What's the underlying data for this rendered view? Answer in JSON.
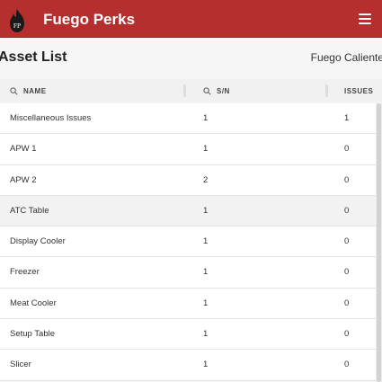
{
  "app": {
    "title": "Fuego Perks",
    "logo_text": "FP",
    "accent": "#b52f2f"
  },
  "page": {
    "title": "Asset List",
    "org": "Fuego Caliente"
  },
  "table": {
    "headers": {
      "name": "NAME",
      "sn": "S/N",
      "issues": "ISSUES"
    },
    "rows": [
      {
        "name": "Miscellaneous Issues",
        "sn": "1",
        "issues": "1"
      },
      {
        "name": "APW 1",
        "sn": "1",
        "issues": "0"
      },
      {
        "name": "APW 2",
        "sn": "2",
        "issues": "0"
      },
      {
        "name": "ATC Table",
        "sn": "1",
        "issues": "0"
      },
      {
        "name": "Display Cooler",
        "sn": "1",
        "issues": "0"
      },
      {
        "name": "Freezer",
        "sn": "1",
        "issues": "0"
      },
      {
        "name": "Meat Cooler",
        "sn": "1",
        "issues": "0"
      },
      {
        "name": "Setup Table",
        "sn": "1",
        "issues": "0"
      },
      {
        "name": "Slicer",
        "sn": "1",
        "issues": "0"
      }
    ]
  }
}
